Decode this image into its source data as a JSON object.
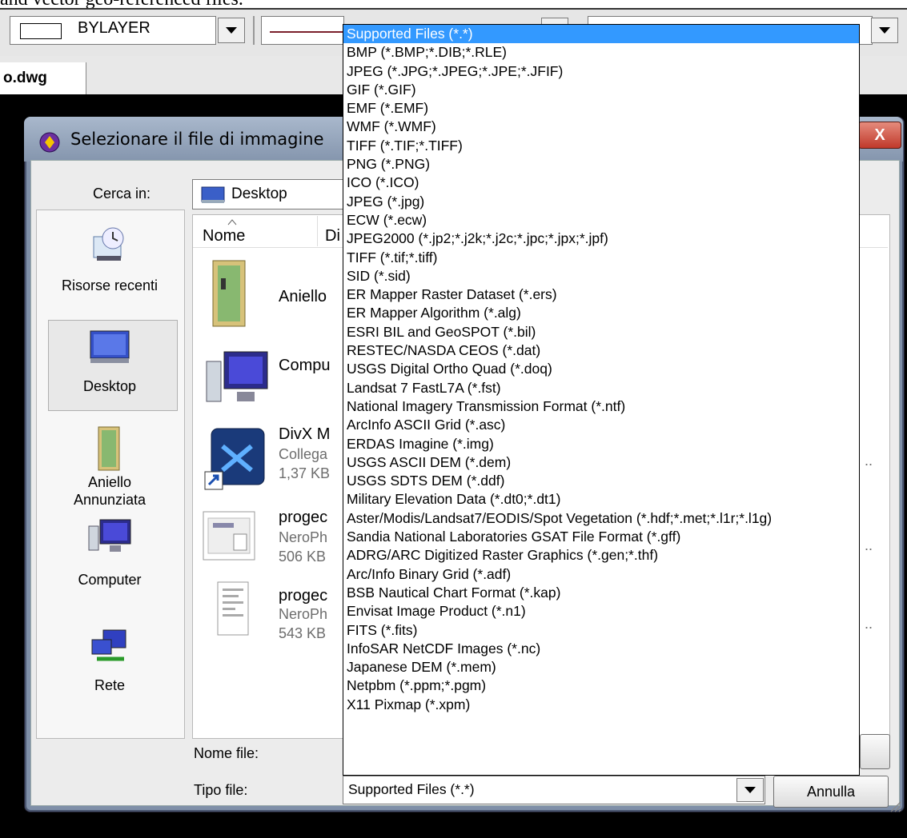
{
  "page": {
    "top_text": "and vector geo-referenced files."
  },
  "toolbar": {
    "color_combo": "BYLAYER",
    "drawing_tab": "o.dwg"
  },
  "dialog": {
    "title": "Selezionare il file di immagine",
    "close_label": "X",
    "look_in_label": "Cerca in:",
    "look_in_value": "Desktop",
    "columns": {
      "name": "Nome",
      "second": "Di"
    },
    "places": [
      {
        "label": "Risorse recenti",
        "icon": "recent-places-icon"
      },
      {
        "label": "Desktop",
        "icon": "desktop-icon"
      },
      {
        "label": "Aniello\nAnnunziata",
        "icon": "user-folder-icon"
      },
      {
        "label": "Computer",
        "icon": "computer-icon"
      },
      {
        "label": "Rete",
        "icon": "network-icon"
      }
    ],
    "files": [
      {
        "name": "Aniello",
        "sub1": "",
        "sub2": "",
        "icon": "user-folder-icon"
      },
      {
        "name": "Compu",
        "sub1": "",
        "sub2": "",
        "icon": "computer-icon"
      },
      {
        "name": "DivX M",
        "sub1": "Collega",
        "sub2": "1,37 KB",
        "icon": "shortcut-icon"
      },
      {
        "name": "progec",
        "sub1": "NeroPh",
        "sub2": "506 KB",
        "icon": "image-thumbnail-icon"
      },
      {
        "name": "progec",
        "sub1": "NeroPh",
        "sub2": "543 KB",
        "icon": "document-thumbnail-icon"
      }
    ],
    "ellipsis": "..",
    "filename_label": "Nome file:",
    "filetype_label": "Tipo file:",
    "filetype_value": "Supported Files (*.*)",
    "cancel_label": "Annulla"
  },
  "filetype_options": [
    "Supported Files (*.*)",
    "BMP (*.BMP;*.DIB;*.RLE)",
    "JPEG (*.JPG;*.JPEG;*.JPE;*.JFIF)",
    "GIF (*.GIF)",
    "EMF (*.EMF)",
    "WMF (*.WMF)",
    "TIFF (*.TIF;*.TIFF)",
    "PNG (*.PNG)",
    "ICO (*.ICO)",
    "JPEG (*.jpg)",
    "ECW (*.ecw)",
    "JPEG2000 (*.jp2;*.j2k;*.j2c;*.jpc;*.jpx;*.jpf)",
    "TIFF (*.tif;*.tiff)",
    "SID (*.sid)",
    "ER Mapper Raster Dataset (*.ers)",
    "ER Mapper Algorithm (*.alg)",
    "ESRI BIL and GeoSPOT (*.bil)",
    "RESTEC/NASDA CEOS (*.dat)",
    "USGS Digital Ortho Quad (*.doq)",
    "Landsat 7 FastL7A (*.fst)",
    "National Imagery Transmission Format (*.ntf)",
    "ArcInfo ASCII Grid (*.asc)",
    "ERDAS Imagine (*.img)",
    "USGS ASCII DEM (*.dem)",
    "USGS SDTS DEM (*.ddf)",
    "Military Elevation Data (*.dt0;*.dt1)",
    "Aster/Modis/Landsat7/EODIS/Spot Vegetation (*.hdf;*.met;*.l1r;*.l1g)",
    "Sandia National Laboratories GSAT File Format (*.gff)",
    "ADRG/ARC Digitized Raster Graphics (*.gen;*.thf)",
    "Arc/Info Binary Grid (*.adf)",
    "BSB Nautical Chart Format (*.kap)",
    "Envisat Image Product (*.n1)",
    "FITS (*.fits)",
    "InfoSAR NetCDF Images (*.nc)",
    "Japanese DEM (*.mem)",
    "Netpbm (*.ppm;*.pgm)",
    "X11 Pixmap (*.xpm)"
  ],
  "selected_option_index": 0,
  "colors": {
    "selection": "#3399ff",
    "drawing_bg": "#000000",
    "line_sample": "#7a1f2b"
  }
}
